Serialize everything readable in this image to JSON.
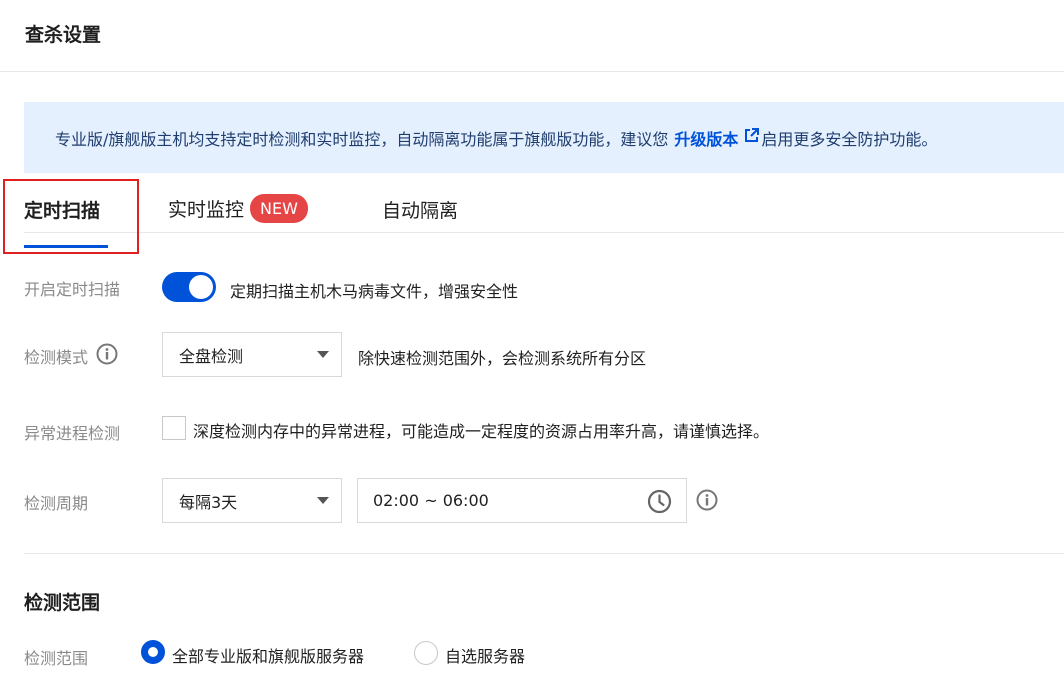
{
  "page": {
    "title": "查杀设置"
  },
  "notice": {
    "text_before": "专业版/旗舰版主机均支持定时检测和实时监控，自动隔离功能属于旗舰版功能，建议您",
    "link_label": "升级版本",
    "text_after": "启用更多安全防护功能。",
    "link_icon": "external-link-icon"
  },
  "tabs": [
    {
      "label": "定时扫描",
      "active": true
    },
    {
      "label": "实时监控",
      "badge": "NEW"
    },
    {
      "label": "自动隔离"
    }
  ],
  "scheduled_scan": {
    "enable": {
      "label": "开启定时扫描",
      "on": true,
      "description": "定期扫描主机木马病毒文件，增强安全性"
    },
    "mode": {
      "label": "检测模式",
      "value": "全盘检测",
      "description": "除快速检测范围外，会检测系统所有分区"
    },
    "process": {
      "label": "异常进程检测",
      "checked": false,
      "description": "深度检测内存中的异常进程，可能造成一定程度的资源占用率升高，请谨慎选择。"
    },
    "period": {
      "label": "检测周期",
      "interval": "每隔3天",
      "time_range": "02:00 ~ 06:00"
    }
  },
  "scope": {
    "section_title": "检测范围",
    "label": "检测范围",
    "options": [
      {
        "label": "全部专业版和旗舰版服务器",
        "selected": true
      },
      {
        "label": "自选服务器",
        "selected": false
      }
    ]
  },
  "colors": {
    "primary": "#0052d9",
    "badge": "#e54545",
    "notice_bg": "#e5f0ff",
    "highlight": "#e02020"
  }
}
